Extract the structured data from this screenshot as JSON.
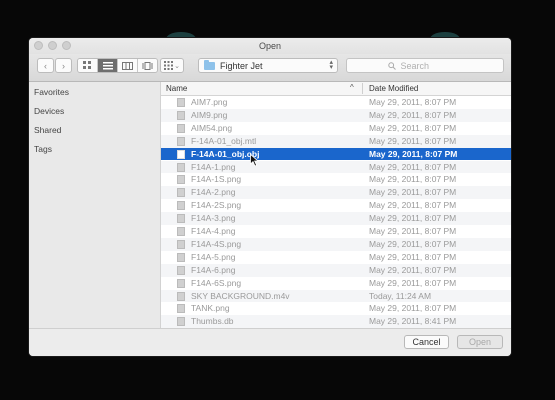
{
  "dialog": {
    "title": "Open"
  },
  "toolbar": {
    "back_icon": "chevron-left-icon",
    "forward_icon": "chevron-right-icon",
    "view_modes": [
      "icon-view",
      "list-view",
      "column-view",
      "cover-flow-view"
    ],
    "active_view": "list-view",
    "arrange_icon": "arrange-grid-icon",
    "location": "Fighter Jet",
    "search_placeholder": "Search"
  },
  "sidebar": {
    "items": [
      {
        "label": "Favorites"
      },
      {
        "label": "Devices"
      },
      {
        "label": "Shared"
      },
      {
        "label": "Tags"
      }
    ]
  },
  "filelist": {
    "headers": {
      "name": "Name",
      "date": "Date Modified"
    },
    "sort_indicator": "^",
    "rows": [
      {
        "name": "AIM7.png",
        "date": "May 29, 2011, 8:07 PM",
        "selected": false
      },
      {
        "name": "AIM9.png",
        "date": "May 29, 2011, 8:07 PM",
        "selected": false
      },
      {
        "name": "AIM54.png",
        "date": "May 29, 2011, 8:07 PM",
        "selected": false
      },
      {
        "name": "F-14A-01_obj.mtl",
        "date": "May 29, 2011, 8:07 PM",
        "selected": false
      },
      {
        "name": "F-14A-01_obj.obj",
        "date": "May 29, 2011, 8:07 PM",
        "selected": true
      },
      {
        "name": "F14A-1.png",
        "date": "May 29, 2011, 8:07 PM",
        "selected": false
      },
      {
        "name": "F14A-1S.png",
        "date": "May 29, 2011, 8:07 PM",
        "selected": false
      },
      {
        "name": "F14A-2.png",
        "date": "May 29, 2011, 8:07 PM",
        "selected": false
      },
      {
        "name": "F14A-2S.png",
        "date": "May 29, 2011, 8:07 PM",
        "selected": false
      },
      {
        "name": "F14A-3.png",
        "date": "May 29, 2011, 8:07 PM",
        "selected": false
      },
      {
        "name": "F14A-4.png",
        "date": "May 29, 2011, 8:07 PM",
        "selected": false
      },
      {
        "name": "F14A-4S.png",
        "date": "May 29, 2011, 8:07 PM",
        "selected": false
      },
      {
        "name": "F14A-5.png",
        "date": "May 29, 2011, 8:07 PM",
        "selected": false
      },
      {
        "name": "F14A-6.png",
        "date": "May 29, 2011, 8:07 PM",
        "selected": false
      },
      {
        "name": "F14A-6S.png",
        "date": "May 29, 2011, 8:07 PM",
        "selected": false
      },
      {
        "name": "SKY BACKGROUND.m4v",
        "date": "Today, 11:24 AM",
        "selected": false
      },
      {
        "name": "TANK.png",
        "date": "May 29, 2011, 8:07 PM",
        "selected": false
      },
      {
        "name": "Thumbs.db",
        "date": "May 29, 2011, 8:41 PM",
        "selected": false
      }
    ]
  },
  "buttons": {
    "cancel": "Cancel",
    "open": "Open"
  },
  "colors": {
    "selection": "#1a66cc",
    "folder": "#8ec2ea"
  }
}
